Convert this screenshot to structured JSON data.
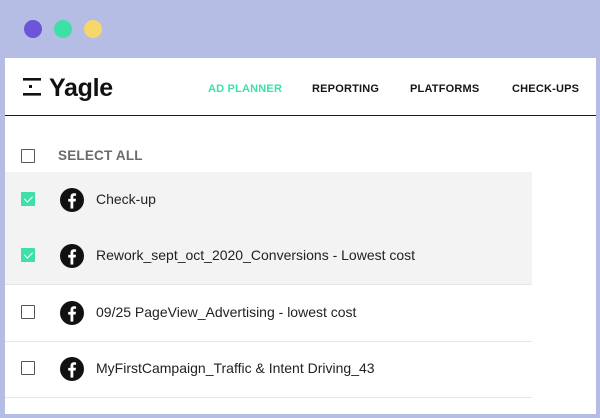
{
  "window": {
    "controls": [
      {
        "name": "close",
        "color": "#6c55d6"
      },
      {
        "name": "minimize",
        "color": "#3ee0a8"
      },
      {
        "name": "maximize",
        "color": "#f6d86a"
      }
    ]
  },
  "header": {
    "brand": "Yagle",
    "nav": [
      {
        "label": "AD PLANNER",
        "active": true
      },
      {
        "label": "REPORTING",
        "active": false
      },
      {
        "label": "PLATFORMS",
        "active": false
      },
      {
        "label": "CHECK-UPS",
        "active": false
      }
    ]
  },
  "list": {
    "select_all_label": "SELECT ALL",
    "select_all_checked": false,
    "rows": [
      {
        "label": "Check-up",
        "checked": true,
        "icon": "facebook-icon"
      },
      {
        "label": "Rework_sept_oct_2020_Conversions - Lowest cost",
        "checked": true,
        "icon": "facebook-icon"
      },
      {
        "label": "09/25 PageView_Advertising - lowest cost",
        "checked": false,
        "icon": "facebook-icon"
      },
      {
        "label": "MyFirstCampaign_Traffic & Intent Driving_43",
        "checked": false,
        "icon": "facebook-icon"
      }
    ]
  },
  "colors": {
    "accent": "#3ee0a8",
    "background": "#b5bde4",
    "selected_row": "#f3f3f3"
  }
}
